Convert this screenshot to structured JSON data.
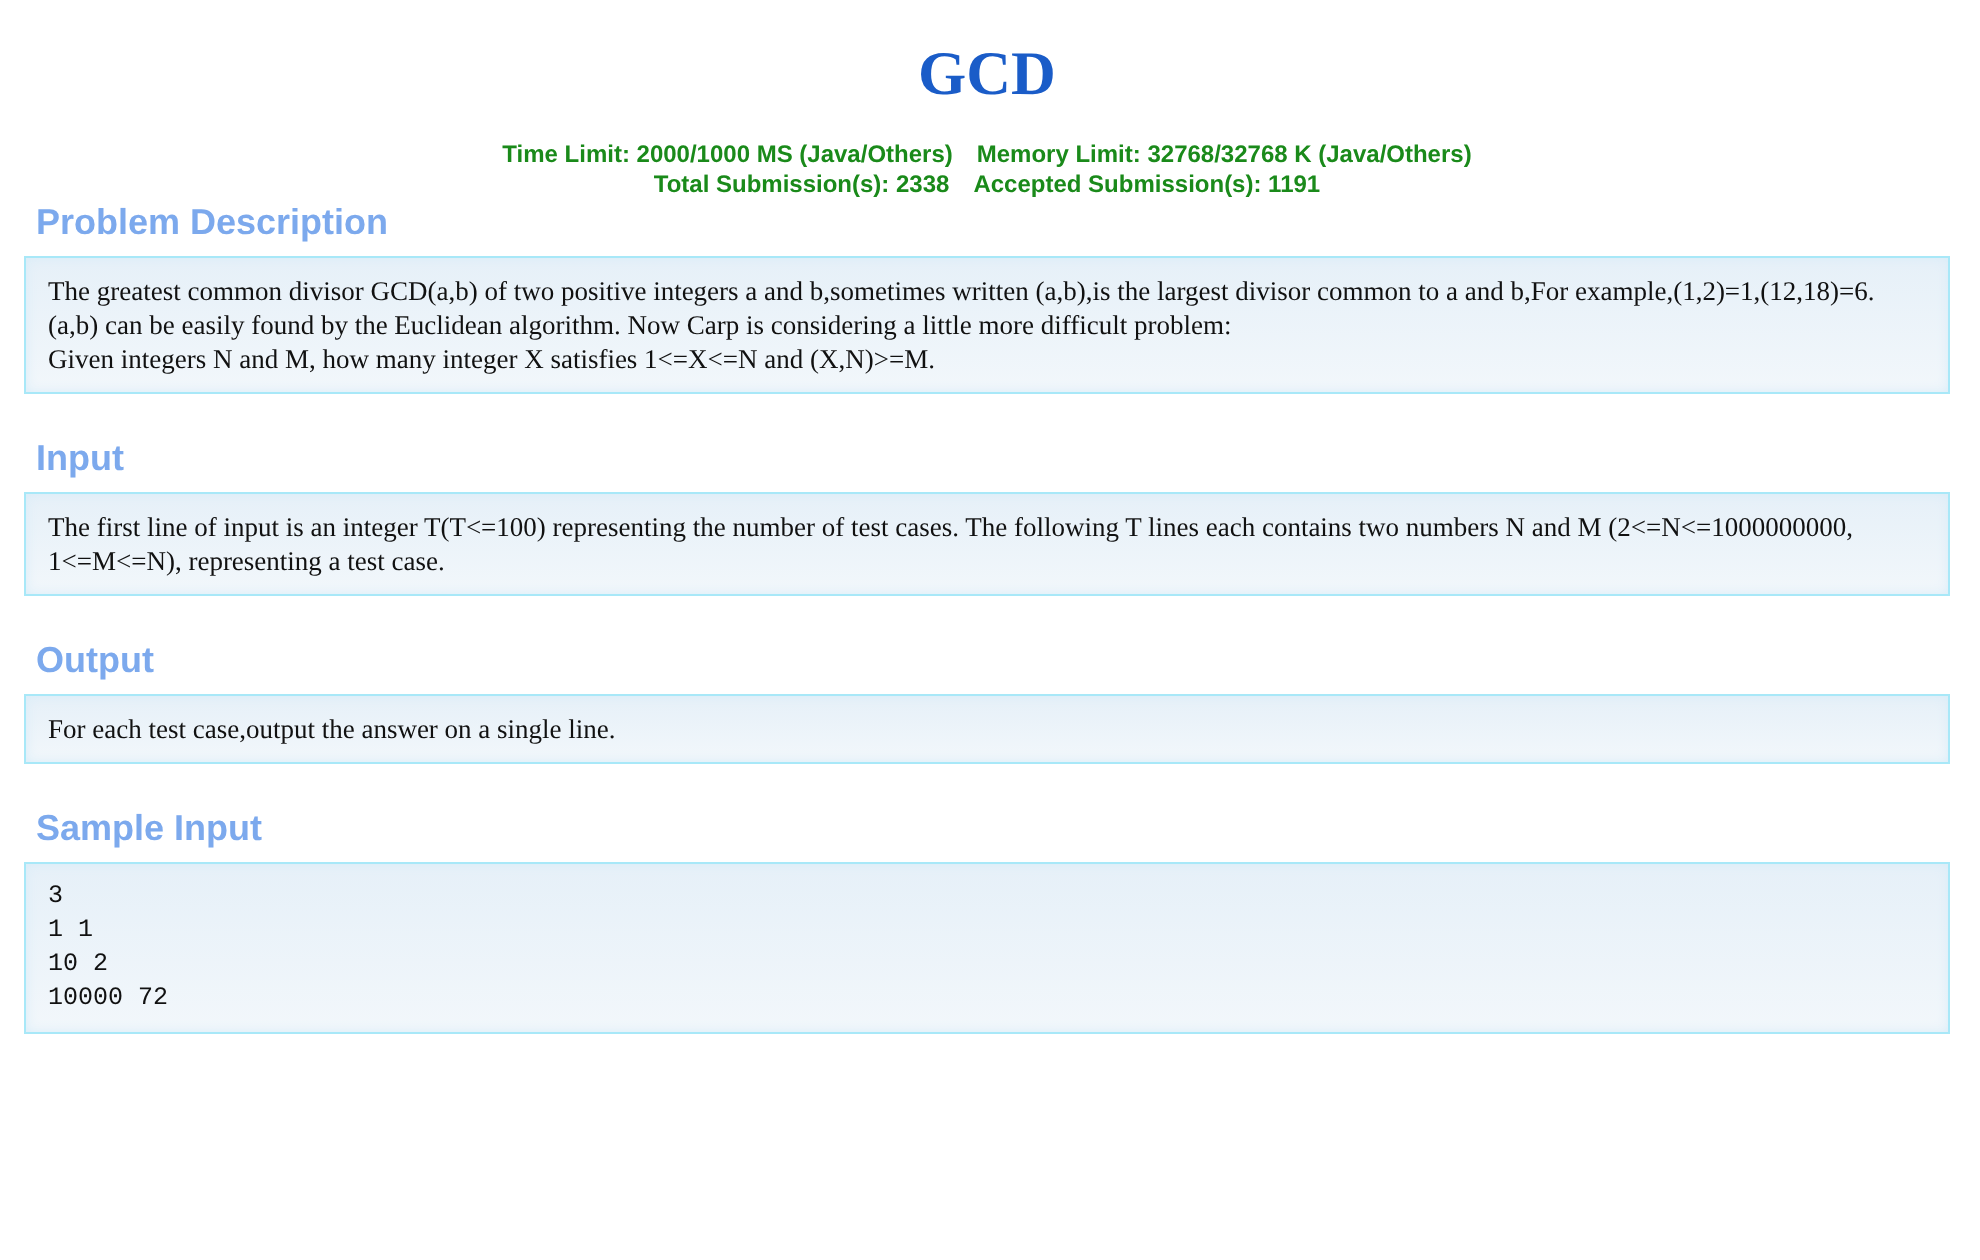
{
  "title": "GCD",
  "limits": [
    "Time Limit: 2000/1000 MS (Java/Others)",
    "Memory Limit: 32768/32768 K (Java/Others)"
  ],
  "submissions": [
    "Total Submission(s): 2338",
    "Accepted Submission(s): 1191"
  ],
  "sections": [
    {
      "heading": "Problem Description",
      "kind": "text",
      "lines": [
        "The greatest common divisor GCD(a,b) of two positive integers a and b,sometimes written (a,b),is the largest divisor common to a and b,For example,(1,2)=1,(12,18)=6.",
        "(a,b) can be easily found by the Euclidean algorithm. Now Carp is considering a little more difficult problem:",
        "Given integers N and M, how many integer X satisfies 1<=X<=N and (X,N)>=M."
      ]
    },
    {
      "heading": "Input",
      "kind": "text",
      "lines": [
        "The first line of input is an integer T(T<=100) representing the number of test cases. The following T lines each contains two numbers N and M (2<=N<=1000000000, 1<=M<=N), representing a test case."
      ]
    },
    {
      "heading": "Output",
      "kind": "text",
      "lines": [
        "For each test case,output the answer on a single line."
      ]
    },
    {
      "heading": "Sample Input",
      "kind": "code",
      "lines": [
        "3",
        "1 1",
        "10 2",
        "10000 72"
      ]
    }
  ]
}
